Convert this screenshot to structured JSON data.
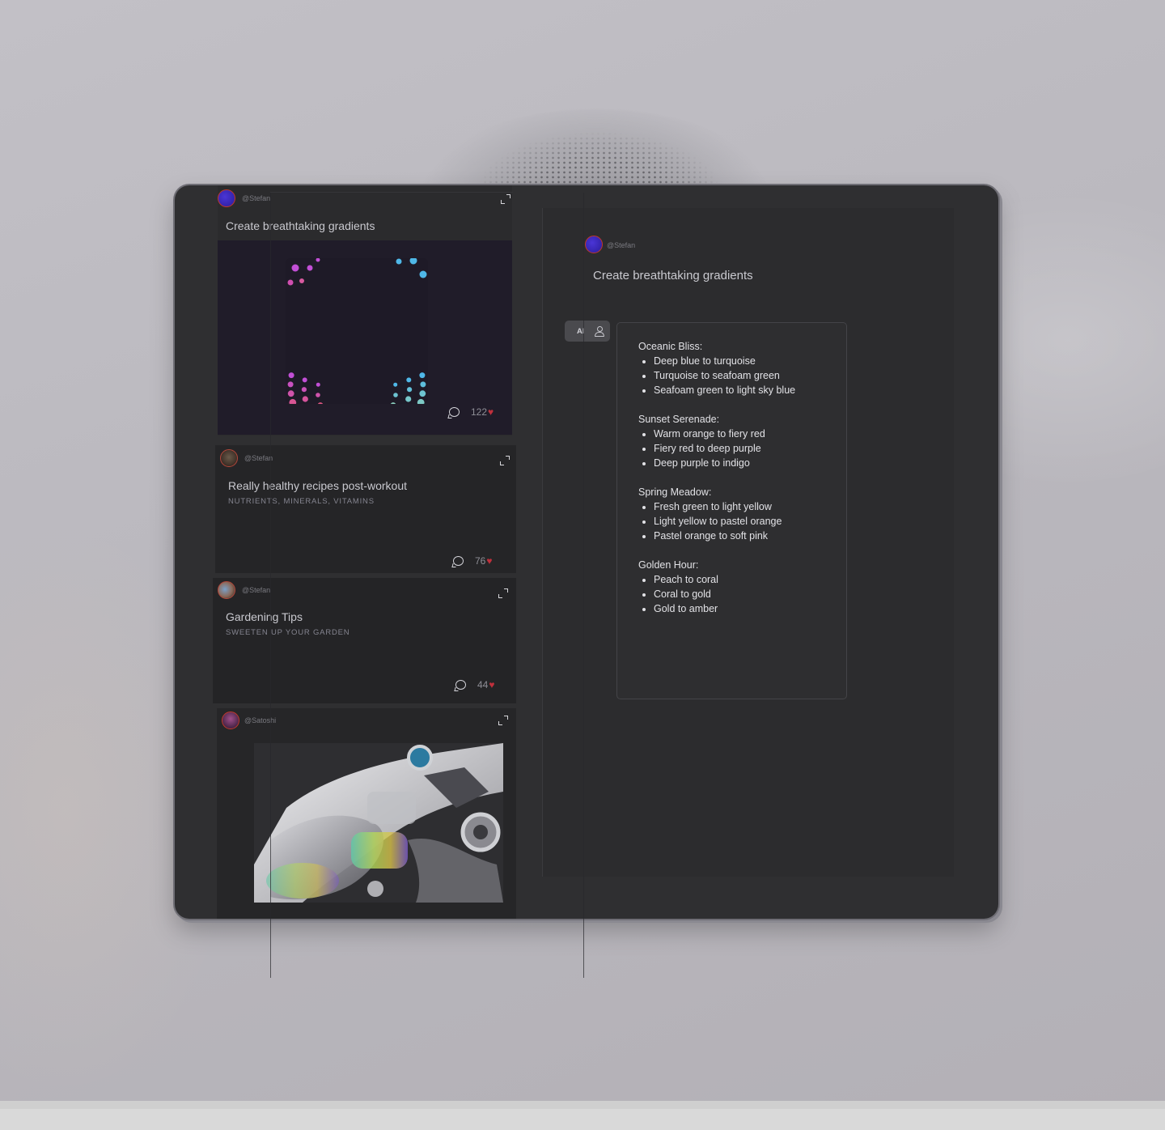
{
  "feed": {
    "cards": [
      {
        "handle": "@Stefan",
        "title": "Create breathtaking gradients",
        "comments_icon": "comment-icon",
        "likes": "122"
      },
      {
        "handle": "@Stefan",
        "title": "Really healthy recipes post-workout",
        "subtitle": "NUTRIENTS, MINERALS, VITAMINS",
        "likes": "76"
      },
      {
        "handle": "@Stefan",
        "title": "Gardening Tips",
        "subtitle": "SWEETEN UP YOUR GARDEN",
        "likes": "44"
      },
      {
        "handle": "@Satoshi"
      }
    ]
  },
  "detail": {
    "handle": "@Stefan",
    "title": "Create breathtaking gradients",
    "ai_toggle_label": "AI",
    "palettes": [
      {
        "name": "Oceanic Bliss:",
        "items": [
          "Deep blue to turquoise",
          "Turquoise to seafoam green",
          "Seafoam green to light sky blue"
        ]
      },
      {
        "name": "Sunset Serenade:",
        "items": [
          "Warm orange to fiery red",
          "Fiery red to deep purple",
          "Deep purple to indigo"
        ]
      },
      {
        "name": "Spring Meadow:",
        "items": [
          "Fresh green to light yellow",
          "Light yellow to pastel orange",
          "Pastel orange to soft pink"
        ]
      },
      {
        "name": "Golden Hour:",
        "items": [
          "Peach to coral",
          "Coral to gold",
          "Gold to amber"
        ]
      }
    ]
  },
  "colors": {
    "device_bg": "#2f2f31",
    "heart": "#c0303c",
    "avatar_ring": "#c0392b",
    "avatar_fill": "#3a28c0"
  }
}
